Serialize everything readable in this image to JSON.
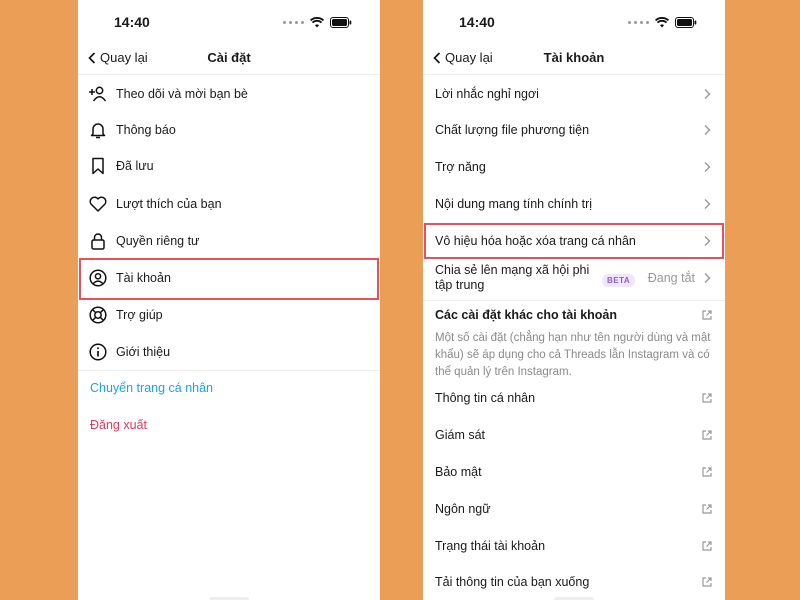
{
  "colors": {
    "background": "#EB9E55",
    "highlight": "#E8505B",
    "link_blue": "#1DA1F2",
    "logout_red": "#E8365C",
    "beta_purple": "#8E5CD9"
  },
  "left_screen": {
    "time": "14:40",
    "back_label": "Quay lại",
    "title": "Cài đặt",
    "items": [
      {
        "label": "Theo dõi và mời bạn bè",
        "icon": "add-person-icon"
      },
      {
        "label": "Thông báo",
        "icon": "bell-icon"
      },
      {
        "label": "Đã lưu",
        "icon": "bookmark-icon"
      },
      {
        "label": "Lượt thích của bạn",
        "icon": "heart-icon"
      },
      {
        "label": "Quyền riêng tư",
        "icon": "lock-icon"
      },
      {
        "label": "Tài khoản",
        "icon": "account-circle-icon"
      },
      {
        "label": "Trợ giúp",
        "icon": "lifebuoy-icon"
      },
      {
        "label": "Giới thiệu",
        "icon": "info-icon"
      }
    ],
    "switch_profile": "Chuyển trang cá nhân",
    "logout": "Đăng xuất"
  },
  "right_screen": {
    "time": "14:40",
    "back_label": "Quay lại",
    "title": "Tài khoản",
    "items": [
      {
        "label": "Lời nhắc nghỉ ngơi"
      },
      {
        "label": "Chất lượng file phương tiện"
      },
      {
        "label": "Trợ năng"
      },
      {
        "label": "Nội dung mang tính chính trị"
      },
      {
        "label": "Vô hiệu hóa hoặc xóa trang cá nhân"
      }
    ],
    "share": {
      "line1": "Chia sẻ lên mạng xã hội phi",
      "line2": "tập trung",
      "badge": "BETA",
      "status": "Đang tắt"
    },
    "other_settings": {
      "title": "Các cài đặt khác cho tài khoản",
      "description": "Một số cài đặt (chẳng hạn như tên người dùng và mật khẩu) sẽ áp dụng cho cả Threads lẫn Instagram và có thể quản lý trên Instagram."
    },
    "external_items": [
      {
        "label": "Thông tin cá nhân"
      },
      {
        "label": "Giám sát"
      },
      {
        "label": "Bảo mật"
      },
      {
        "label": "Ngôn ngữ"
      },
      {
        "label": "Trạng thái tài khoản"
      },
      {
        "label": "Tải thông tin của bạn xuống"
      }
    ]
  }
}
